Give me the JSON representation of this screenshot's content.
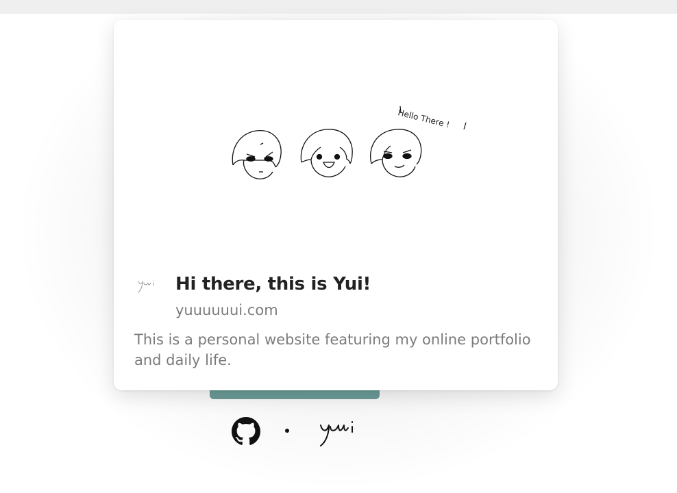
{
  "link_card": {
    "illustration_caption": "Hello There !",
    "favicon_text": "yui",
    "title": "Hi there, this is Yui!",
    "domain": "yuuuuuui.com",
    "description": "This is a personal website featuring my online portfolio and daily life."
  },
  "footer": {
    "github_icon": "github-icon",
    "separator": "·",
    "signature_icon": "yui-signature-logo"
  },
  "colors": {
    "accent": "#6a9a96",
    "title": "#222222",
    "muted": "#7b7b7b"
  }
}
